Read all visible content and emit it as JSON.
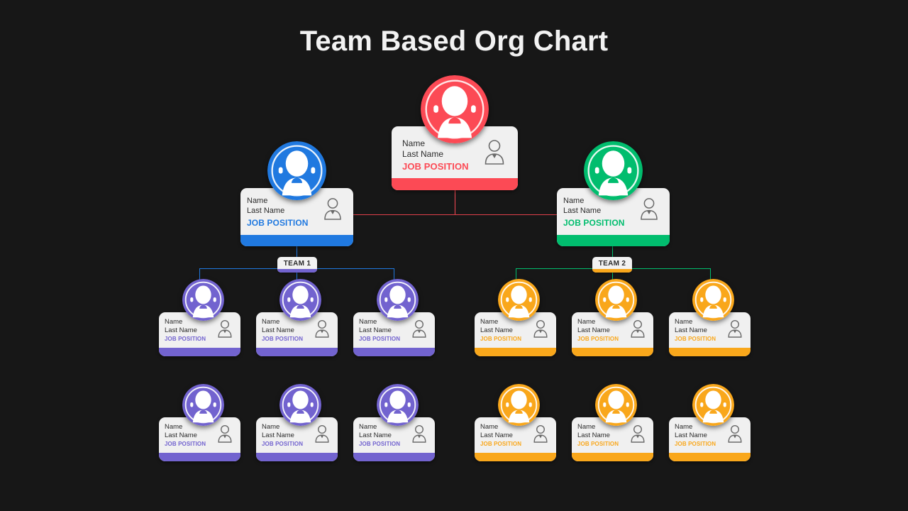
{
  "page": {
    "title": "Team Based Org Chart",
    "background_color": "#171717"
  },
  "colors": {
    "red": "#fc4a55",
    "blue": "#2079e0",
    "green": "#01bd6e",
    "purple": "#7263cf",
    "orange": "#f9a71b",
    "card_bg": "#f0f0f0",
    "name_text": "#2b2b2b",
    "title_text": "#f2f2f2"
  },
  "labels": {
    "name": "Name",
    "last_name": "Last Name",
    "job_position": "JOB POSITION",
    "person_badge_icon": "person-badge-icon",
    "avatar_icon": "avatar-icon"
  },
  "team_labels": [
    {
      "id": "team-1",
      "label": "TEAM 1",
      "accent": "#7263cf"
    },
    {
      "id": "team-2",
      "label": "TEAM 2",
      "accent": "#f9a71b"
    }
  ],
  "nodes": {
    "root": {
      "id": "ceo",
      "name": "Name",
      "last_name": "Last Name",
      "job_position": "JOB POSITION",
      "color": "#fc4a55"
    },
    "branch_left": {
      "id": "manager-1",
      "name": "Name",
      "last_name": "Last Name",
      "job_position": "JOB POSITION",
      "color": "#2079e0"
    },
    "branch_right": {
      "id": "manager-2",
      "name": "Name",
      "last_name": "Last Name",
      "job_position": "JOB POSITION",
      "color": "#01bd6e"
    },
    "team1_row1": [
      {
        "id": "t1-m1",
        "name": "Name",
        "last_name": "Last Name",
        "job_position": "JOB POSITION",
        "color": "#7263cf"
      },
      {
        "id": "t1-m2",
        "name": "Name",
        "last_name": "Last Name",
        "job_position": "JOB POSITION",
        "color": "#7263cf"
      },
      {
        "id": "t1-m3",
        "name": "Name",
        "last_name": "Last Name",
        "job_position": "JOB POSITION",
        "color": "#7263cf"
      }
    ],
    "team1_row2": [
      {
        "id": "t1-m4",
        "name": "Name",
        "last_name": "Last Name",
        "job_position": "JOB POSITION",
        "color": "#7263cf"
      },
      {
        "id": "t1-m5",
        "name": "Name",
        "last_name": "Last Name",
        "job_position": "JOB POSITION",
        "color": "#7263cf"
      },
      {
        "id": "t1-m6",
        "name": "Name",
        "last_name": "Last Name",
        "job_position": "JOB POSITION",
        "color": "#7263cf"
      }
    ],
    "team2_row1": [
      {
        "id": "t2-m1",
        "name": "Name",
        "last_name": "Last Name",
        "job_position": "JOB POSITION",
        "color": "#f9a71b"
      },
      {
        "id": "t2-m2",
        "name": "Name",
        "last_name": "Last Name",
        "job_position": "JOB POSITION",
        "color": "#f9a71b"
      },
      {
        "id": "t2-m3",
        "name": "Name",
        "last_name": "Last Name",
        "job_position": "JOB POSITION",
        "color": "#f9a71b"
      }
    ],
    "team2_row2": [
      {
        "id": "t2-m4",
        "name": "Name",
        "last_name": "Last Name",
        "job_position": "JOB POSITION",
        "color": "#f9a71b"
      },
      {
        "id": "t2-m5",
        "name": "Name",
        "last_name": "Last Name",
        "job_position": "JOB POSITION",
        "color": "#f9a71b"
      },
      {
        "id": "t2-m6",
        "name": "Name",
        "last_name": "Last Name",
        "job_position": "JOB POSITION",
        "color": "#f9a71b"
      }
    ]
  }
}
